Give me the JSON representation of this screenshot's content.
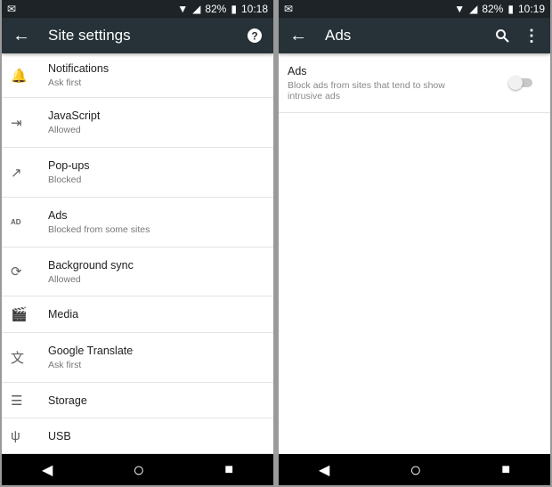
{
  "left": {
    "status": {
      "battery": "82%",
      "time": "10:18"
    },
    "toolbar": {
      "title": "Site settings"
    },
    "items": [
      {
        "label": "Notifications",
        "sub": "Ask first",
        "icon": "bell-icon",
        "glyph": "🔔"
      },
      {
        "label": "JavaScript",
        "sub": "Allowed",
        "icon": "javascript-icon",
        "glyph": "⇥"
      },
      {
        "label": "Pop-ups",
        "sub": "Blocked",
        "icon": "popup-icon",
        "glyph": "↗"
      },
      {
        "label": "Ads",
        "sub": "Blocked from some sites",
        "icon": "ads-icon",
        "glyph": "AD"
      },
      {
        "label": "Background sync",
        "sub": "Allowed",
        "icon": "sync-icon",
        "glyph": "⟳"
      },
      {
        "label": "Media",
        "sub": "",
        "icon": "media-icon",
        "glyph": "🎬"
      },
      {
        "label": "Google Translate",
        "sub": "Ask first",
        "icon": "translate-icon",
        "glyph": "文"
      },
      {
        "label": "Storage",
        "sub": "",
        "icon": "storage-icon",
        "glyph": "☰"
      },
      {
        "label": "USB",
        "sub": "",
        "icon": "usb-icon",
        "glyph": "ψ"
      }
    ]
  },
  "right": {
    "status": {
      "battery": "82%",
      "time": "10:19"
    },
    "toolbar": {
      "title": "Ads"
    },
    "ads": {
      "label": "Ads",
      "description": "Block ads from sites that tend to show intrusive ads",
      "enabled": false
    }
  },
  "nav": {
    "back": "◀",
    "home": "○",
    "recents": "■"
  }
}
